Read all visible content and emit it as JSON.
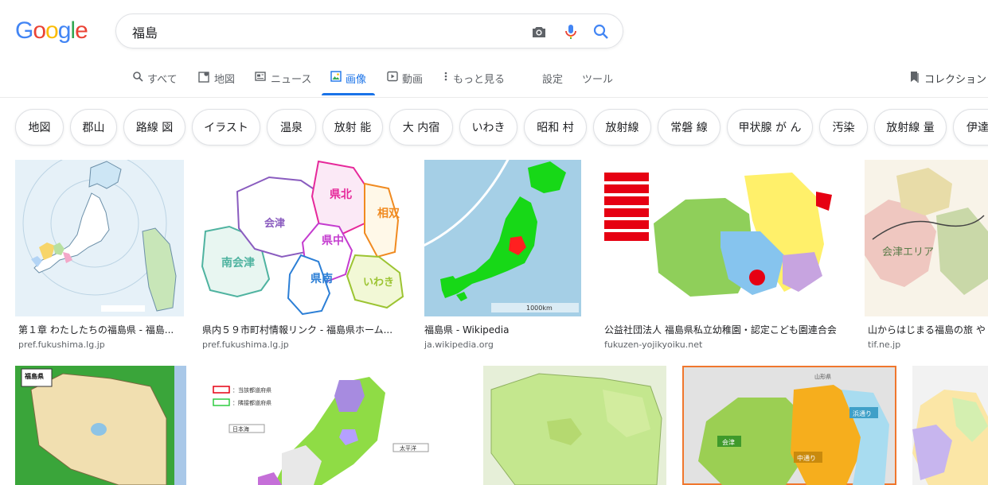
{
  "search": {
    "query": "福島"
  },
  "tabs": [
    {
      "label": "すべて"
    },
    {
      "label": "地図"
    },
    {
      "label": "ニュース"
    },
    {
      "label": "画像"
    },
    {
      "label": "動画"
    },
    {
      "label": "もっと見る"
    },
    {
      "label": "設定"
    },
    {
      "label": "ツール"
    }
  ],
  "collection_label": "コレクション",
  "chips": [
    "地図",
    "郡山",
    "路線 図",
    "イラスト",
    "温泉",
    "放射 能",
    "大 内宿",
    "いわき",
    "昭和 村",
    "放射線",
    "常磐 線",
    "甲状腺 が ん",
    "汚染",
    "放射線 量",
    "伊達"
  ],
  "results_row1": [
    {
      "title": "第１章 わたしたちの福島県 - 福島...",
      "domain": "pref.fukushima.lg.jp"
    },
    {
      "title": "県内５９市町村情報リンク - 福島県ホーム...",
      "domain": "pref.fukushima.lg.jp"
    },
    {
      "title": "福島県 - Wikipedia",
      "domain": "ja.wikipedia.org"
    },
    {
      "title": "公益社団法人 福島県私立幼稚園・認定こども園連合会",
      "domain": "fukuzen-yojikyoiku.net"
    },
    {
      "title": "山からはじまる福島の旅 や",
      "domain": "tif.ne.jp"
    }
  ],
  "image_text": {
    "r1_2": {
      "kenboku": "県北",
      "soso": "相双",
      "aizu": "会津",
      "kenchu": "県中",
      "minamiaizu": "南会津",
      "kennan": "県南",
      "iwaki": "いわき"
    },
    "r1_3": {
      "scale": "1000km"
    },
    "r1_5": {
      "aizu_area": "会津エリア"
    },
    "r2_1": {
      "title": "福島県"
    },
    "r2_2": {
      "legend1": "：当該都道府県",
      "legend2": "：隣接都道府県",
      "nihonkai": "日本海",
      "taiheiyo": "太平洋"
    },
    "r2_4": {
      "aizu": "会津",
      "nakadori": "中通り",
      "hamadori": "浜通り",
      "yamagata": "山形県"
    }
  },
  "colors": {
    "accent": "#1a73e8",
    "google_blue": "#4285f4",
    "google_red": "#ea4335",
    "google_yellow": "#fbbc05",
    "google_green": "#34a853"
  }
}
